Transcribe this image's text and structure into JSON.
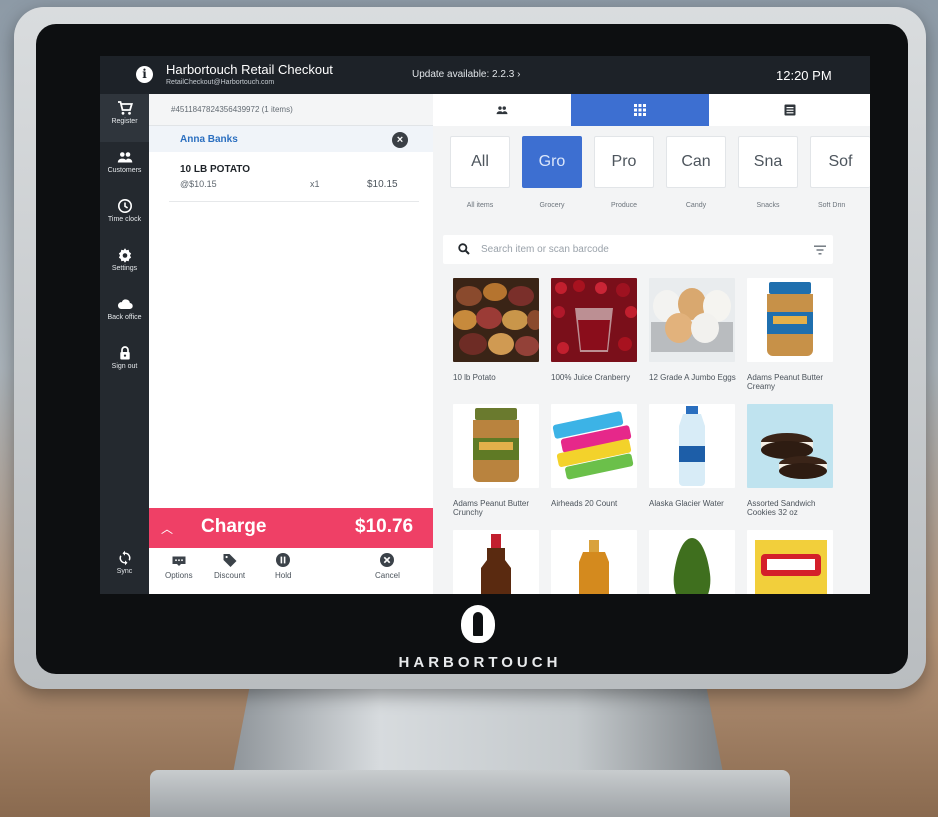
{
  "device": {
    "brand": "HARBORTOUCH"
  },
  "header": {
    "info_icon": "info-icon",
    "app_title": "Harbortouch Retail Checkout",
    "app_email": "RetailCheckout@Harbortouch.com",
    "update_text": "Update available: 2.2.3 ›",
    "time": "12:20 PM"
  },
  "sidebar": {
    "items": [
      {
        "label": "Register",
        "icon": "cart-icon"
      },
      {
        "label": "Customers",
        "icon": "people-icon"
      },
      {
        "label": "Time clock",
        "icon": "clock-icon"
      },
      {
        "label": "Settings",
        "icon": "gear-icon"
      },
      {
        "label": "Back office",
        "icon": "cloud-icon"
      },
      {
        "label": "Sign out",
        "icon": "lock-icon"
      },
      {
        "label": "Sync",
        "icon": "sync-icon"
      }
    ]
  },
  "ticket": {
    "id": "#4511847824356439972 (1 items)",
    "customer": "Anna Banks",
    "items": [
      {
        "name": "10 LB POTATO",
        "unit_price": "@$10.15",
        "qty": "x1",
        "total": "$10.15"
      }
    ],
    "charge_label": "Charge",
    "charge_amount": "$10.76",
    "actions": [
      {
        "label": "Options",
        "icon": "options-icon"
      },
      {
        "label": "Discount",
        "icon": "tag-icon"
      },
      {
        "label": "Hold",
        "icon": "pause-icon"
      },
      {
        "label": "Cancel",
        "icon": "cancel-icon"
      }
    ]
  },
  "catalog": {
    "view_tabs": [
      {
        "name": "customers-view",
        "icon": "people-icon",
        "active": false
      },
      {
        "name": "grid-view",
        "icon": "grid-icon",
        "active": true
      },
      {
        "name": "list-view",
        "icon": "list-icon",
        "active": false
      }
    ],
    "categories": [
      {
        "tile": "All",
        "caption": "All items",
        "active": false
      },
      {
        "tile": "Gro",
        "caption": "Grocery",
        "active": true
      },
      {
        "tile": "Pro",
        "caption": "Produce",
        "active": false
      },
      {
        "tile": "Can",
        "caption": "Candy",
        "active": false
      },
      {
        "tile": "Sna",
        "caption": "Snacks",
        "active": false
      },
      {
        "tile": "Sof",
        "caption": "Soft Drin",
        "active": false
      }
    ],
    "search_placeholder": "Search item or scan barcode",
    "products": [
      {
        "name": "10 lb Potato"
      },
      {
        "name": "100% Juice Cranberry"
      },
      {
        "name": "12 Grade A Jumbo Eggs"
      },
      {
        "name": "Adams Peanut Butter Creamy"
      },
      {
        "name": "Adams Peanut Butter Crunchy"
      },
      {
        "name": "Airheads 20 Count"
      },
      {
        "name": "Alaska Glacier Water"
      },
      {
        "name": "Assorted Sandwich Cookies 32 oz"
      },
      {
        "name": ""
      },
      {
        "name": ""
      },
      {
        "name": ""
      },
      {
        "name": ""
      }
    ]
  },
  "colors": {
    "accent_blue": "#3d6fd1",
    "charge_red": "#ef4066",
    "topbar": "#1d2228",
    "sidebar": "#24292f"
  }
}
